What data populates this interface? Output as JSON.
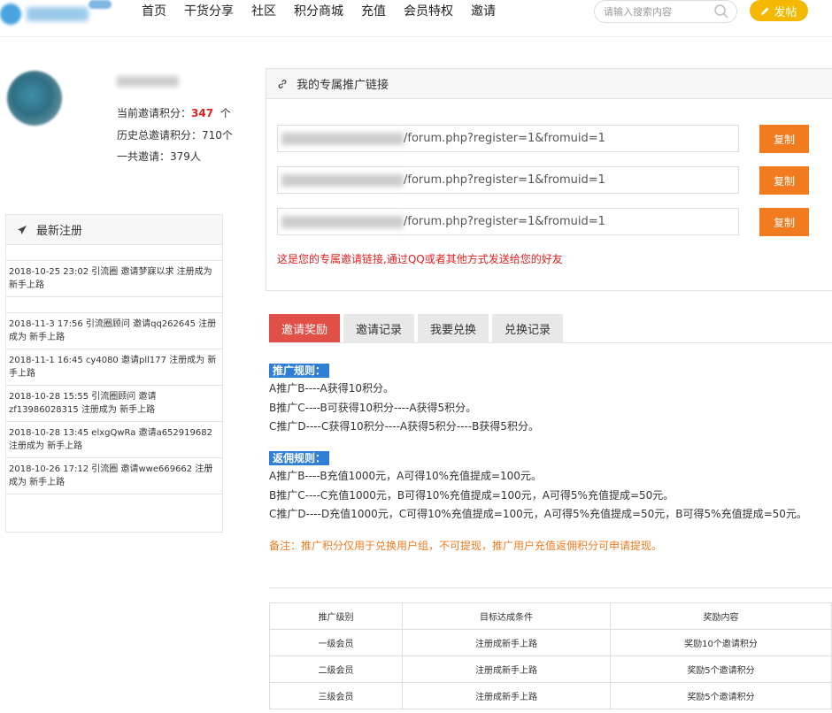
{
  "header": {
    "nav": [
      "首页",
      "干货分享",
      "社区",
      "积分商城",
      "充值",
      "会员特权",
      "邀请"
    ],
    "search_placeholder": "请输入搜索内容",
    "post_button": "发帖"
  },
  "user": {
    "points_label": "当前邀请积分：",
    "points_value": "347",
    "points_unit": "个",
    "history_label": "历史总邀请积分：",
    "history_value": "710个",
    "total_label": "一共邀请：",
    "total_value": "379人"
  },
  "latest": {
    "title": "最新注册",
    "items": [
      "2018-10-25 23:02 引流圈 邀请梦寐以求 注册成为 新手上路",
      "2018-11-3 17:56 引流圈顾问 邀请qq262645 注册成为 新手上路",
      "2018-11-1 16:45 cy4080 邀请pll177 注册成为 新手上路",
      "2018-10-28 15:55 引流圈顾问 邀请zf13986028315 注册成为 新手上路",
      "2018-10-28 13:45 elxgQwRa 邀请a652919682 注册成为 新手上路",
      "2018-10-26 17:12 引流圈 邀请wwe669662 注册成为 新手上路"
    ]
  },
  "promo": {
    "title": "我的专属推广链接",
    "links": [
      "/forum.php?register=1&fromuid=1",
      "/forum.php?register=1&fromuid=1",
      "/forum.php?register=1&fromuid=1"
    ],
    "copy_label": "复制",
    "note": "这是您的专属邀请链接,通过QQ或者其他方式发送给您的好友"
  },
  "tabs": [
    "邀请奖励",
    "邀请记录",
    "我要兑换",
    "兑换记录"
  ],
  "rules": {
    "promo_badge": "推广规则：",
    "promo_lines": [
      "A推广B----A获得10积分。",
      "B推广C----B可获得10积分----A获得5积分。",
      "C推广D----C获得10积分----A获得5积分----B获得5积分。"
    ],
    "rebate_badge": "返佣规则：",
    "rebate_lines": [
      "A推广B----B充值1000元，A可得10%充值提成=100元。",
      "B推广C----C充值1000元，B可得10%充值提成=100元，A可得5%充值提成=50元。",
      "C推广D----D充值1000元，C可得10%充值提成=100元，A可得5%充值提成=50元，B可得5%充值提成=50元。"
    ],
    "note": "备注：推广积分仅用于兑换用户组，不可提现，推广用户充值返佣积分可申请提现。"
  },
  "table": {
    "headers": [
      "推广级别",
      "目标达成条件",
      "奖励内容"
    ],
    "rows": [
      [
        "一级会员",
        "注册成新手上路",
        "奖励10个邀请积分"
      ],
      [
        "二级会员",
        "注册成新手上路",
        "奖励5个邀请积分"
      ],
      [
        "三级会员",
        "注册成新手上路",
        "奖励5个邀请积分"
      ]
    ]
  },
  "colors": {
    "accent_red": "#e02020",
    "copy_orange": "#f27b20",
    "tab_active": "#e05047",
    "badge_blue": "#2f7fd6",
    "post_yellow": "#f5b800"
  }
}
